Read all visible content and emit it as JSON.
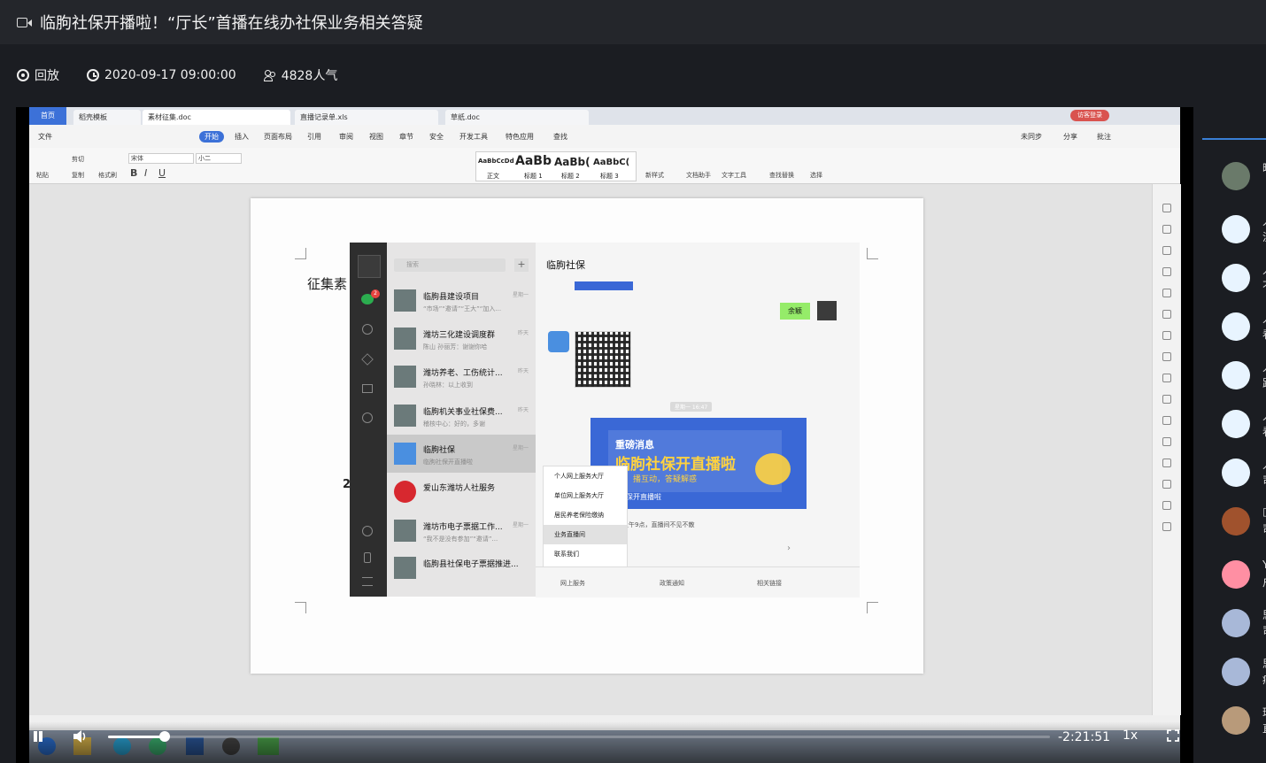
{
  "header": {
    "title": "临朐社保开播啦！“厅长”首播在线办社保业务相关答疑",
    "status": "回放",
    "datetime": "2020-09-17 09:00:00",
    "popularity": "4828人气"
  },
  "wps": {
    "tabs": [
      "首页",
      "稻壳模板",
      "素材征集.doc",
      "直播记录单.xls",
      "草纸.doc"
    ],
    "visitor_badge": "访客登录",
    "menu": [
      "文件",
      "开始",
      "插入",
      "页面布局",
      "引用",
      "审阅",
      "视图",
      "章节",
      "安全",
      "开发工具",
      "特色应用",
      "查找"
    ],
    "menu_right": [
      "未同步",
      "分享",
      "批注"
    ],
    "font_name": "宋体",
    "font_size": "小二",
    "styles": [
      "AaBbCcDd",
      "AaBb",
      "AaBb(",
      "AaBbC("
    ],
    "style_names": [
      "正文",
      "标题 1",
      "标题 2",
      "标题 3"
    ],
    "ribbon_tools": [
      "新样式",
      "文档助手",
      "文字工具",
      "查找替换",
      "选择",
      "粘贴",
      "剪切",
      "复制",
      "格式刷"
    ]
  },
  "document": {
    "text_visible": "征集素",
    "digit": "2"
  },
  "wechat": {
    "chat_title": "临朐社保",
    "search_placeholder": "搜索",
    "contacts": [
      {
        "name": "临朐县建设项目",
        "sub": "“市场”“邀请”“王大”“加入...",
        "time": "星期一"
      },
      {
        "name": "潍坊三化建设调度群",
        "sub": "陈山 孙丽芳：谢谢你哈",
        "time": "昨天"
      },
      {
        "name": "潍坊养老、工伤统计...",
        "sub": "孙晓林：以上收到",
        "time": "昨天"
      },
      {
        "name": "临朐机关事业社保费...",
        "sub": "稽核中心：好的，多谢",
        "time": "昨天"
      },
      {
        "name": "临朐社保",
        "sub": "临朐社保开直播啦",
        "time": "星期一"
      },
      {
        "name": "爱山东潍坊人社服务",
        "sub": "",
        "time": ""
      },
      {
        "name": "潍坊市电子票据工作...",
        "sub": "“我不是没有参加”“邀请”...",
        "time": "星期一"
      },
      {
        "name": "临朐县社保电子票据推进...",
        "sub": "",
        "time": ""
      }
    ],
    "badge_count": "2",
    "sender_tag": "余颖",
    "timestamp": "星期一 16:47",
    "banner_line1": "重磅消息",
    "banner_line2": "临朐社保开直播啦",
    "banner_line3": "播互动，答疑解惑",
    "banner_line4": "保开直播啦",
    "message_text": "上午9点，直播间不见不散",
    "popup_menu": [
      "个人网上服务大厅",
      "单位网上服务大厅",
      "居民养老保险缴纳",
      "业务直播间",
      "联系我们"
    ],
    "bottom_menu": [
      "网上服务",
      "政策通知",
      "相关链接"
    ]
  },
  "player": {
    "time_remaining": "-2:21:51",
    "speed": "1x",
    "progress": 0.06
  },
  "sidebar": {
    "chars": [
      "晒",
      "人",
      "人",
      "人",
      "人",
      "人",
      "人",
      "□",
      "Y",
      "思",
      "思",
      "瑞"
    ],
    "chars2": [
      "",
      "渣",
      "不",
      "看",
      "趾",
      "看",
      "司",
      "司",
      "户",
      "司",
      "痛",
      "直"
    ]
  },
  "colors": {
    "accent": "#3a7fd5",
    "wps_blue": "#3c71d8",
    "banner_blue": "#3a68d6",
    "banner_yellow": "#ffd23f"
  }
}
